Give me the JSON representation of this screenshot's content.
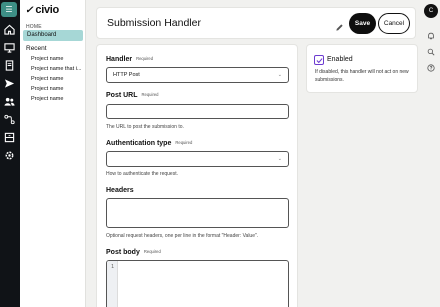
{
  "brand": {
    "name": "civio"
  },
  "sidebar": {
    "home": "HOME",
    "dashboard": "Dashboard",
    "recent": "Recent",
    "projects": [
      "Project name",
      "Project name that i...",
      "Project name",
      "Project name",
      "Project name"
    ]
  },
  "user": {
    "initial": "C"
  },
  "header": {
    "title": "Submission Handler",
    "save": "Save",
    "cancel": "Cancel"
  },
  "form": {
    "handler": {
      "label": "Handler",
      "required": "Required",
      "value": "HTTP Post"
    },
    "post_url": {
      "label": "Post URL",
      "required": "Required",
      "value": "",
      "help": "The URL to post the submission to."
    },
    "auth": {
      "label": "Authentication type",
      "required": "Required",
      "value": "",
      "help": "How to authenticate the request."
    },
    "headers": {
      "label": "Headers",
      "value": "",
      "help": "Optional request headers, one per line in the format \"Header: Value\"."
    },
    "post_body": {
      "label": "Post body",
      "required": "Required",
      "line_number": "1"
    }
  },
  "enabled_card": {
    "label": "Enabled",
    "checked": true,
    "note": "If disabled, this handler will not act on new submissions."
  },
  "colors": {
    "accent": "#a6d7d6",
    "checkbox": "#6c3bd0",
    "rail": "#101317",
    "primary_button": "#0e0e0e"
  },
  "icons": {
    "rail": [
      "menu-icon",
      "home-icon",
      "monitor-icon",
      "document-icon",
      "send-icon",
      "users-icon",
      "workflow-icon",
      "archive-icon",
      "settings-icon"
    ],
    "right": [
      "bell-icon",
      "search-icon",
      "help-icon"
    ]
  }
}
